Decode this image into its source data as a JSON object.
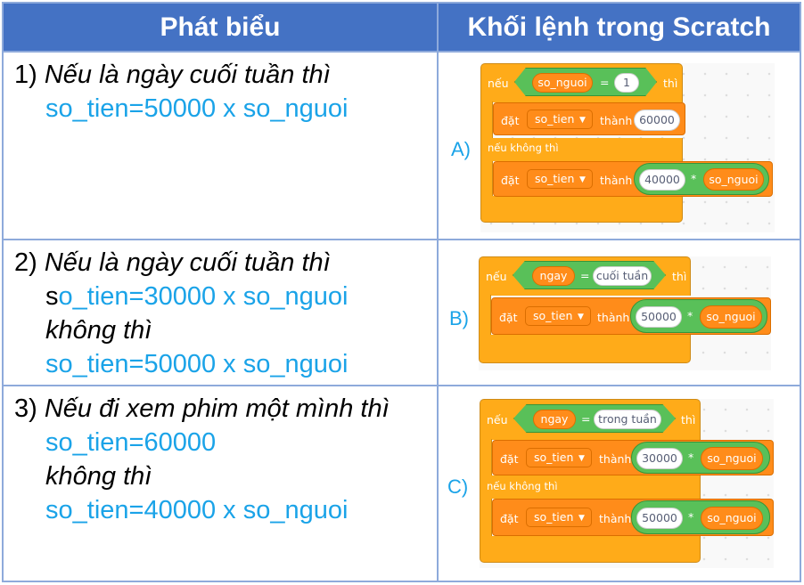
{
  "header": {
    "col1": "Phát biểu",
    "col2": "Khối lệnh trong Scratch"
  },
  "rows": [
    {
      "num": "1)",
      "cond": "Nếu là ngày cuối tuần thì",
      "then": "so_tien=50000 x so_nguoi",
      "label": "A)",
      "block": {
        "if_word": "nếu",
        "var": "so_nguoi",
        "op": "=",
        "val": "1",
        "then_word": "thì",
        "set1": "đặt",
        "set1_var": "so_tien",
        "to1": "thành",
        "val1": "60000",
        "else_word": "nếu không thì",
        "set2": "đặt",
        "set2_var": "so_tien",
        "to2": "thành",
        "val2": "40000",
        "mul2": "*",
        "var2": "so_nguoi"
      }
    },
    {
      "num": "2)",
      "cond": "Nếu là ngày cuối tuần thì",
      "then_s": "s",
      "then_rest": "o_tien=30000 x so_nguoi",
      "else": "không thì",
      "else_val": "so_tien=50000 x so_nguoi",
      "label": "B)",
      "block": {
        "if_word": "nếu",
        "var": "ngay",
        "op": "=",
        "val": "cuối tuần",
        "then_word": "thì",
        "set1": "đặt",
        "set1_var": "so_tien",
        "to1": "thành",
        "val1": "50000",
        "mul1": "*",
        "var1": "so_nguoi"
      }
    },
    {
      "num": "3)",
      "cond": "Nếu đi xem phim một mình thì",
      "then": "so_tien=60000",
      "else": "không thì",
      "else_val": "so_tien=40000 x so_nguoi",
      "label": "C)",
      "block": {
        "if_word": "nếu",
        "var": "ngay",
        "op": "=",
        "val": "trong tuần",
        "then_word": "thì",
        "set1": "đặt",
        "set1_var": "so_tien",
        "to1": "thành",
        "val1": "30000",
        "mul1": "*",
        "var1": "so_nguoi",
        "else_word": "nếu không thì",
        "set2": "đặt",
        "set2_var": "so_tien",
        "to2": "thành",
        "val2": "50000",
        "mul2": "*",
        "var2": "so_nguoi"
      }
    }
  ],
  "colors": {
    "header_bg": "#4472c4",
    "border": "#8eaadb",
    "accent_blue": "#1aa3e8",
    "control": "#ffab19",
    "variable": "#ff8c1a",
    "operator": "#59c059"
  },
  "icons": {
    "dropdown": "caret-down-icon"
  }
}
